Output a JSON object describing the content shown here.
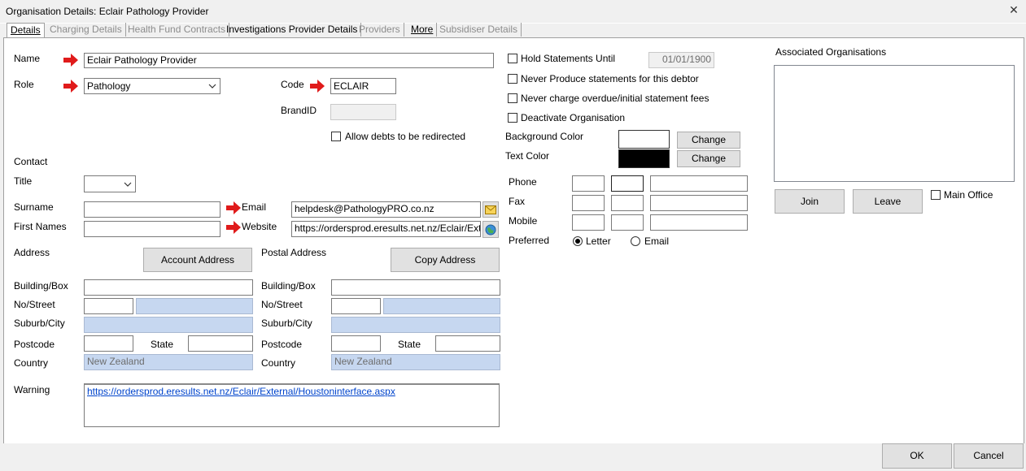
{
  "window": {
    "title": "Organisation Details: Eclair Pathology Provider",
    "close_glyph": "✕"
  },
  "tabs": [
    {
      "label": "Details",
      "state": "active"
    },
    {
      "label": "Charging Details",
      "state": "disabled"
    },
    {
      "label": "Health Fund Contracts",
      "state": "disabled"
    },
    {
      "label": "Investigations Provider Details",
      "state": "normal"
    },
    {
      "label": "Providers",
      "state": "disabled"
    },
    {
      "label": "More",
      "state": "normal"
    },
    {
      "label": "Subsidiser Details",
      "state": "disabled"
    }
  ],
  "form": {
    "name_label": "Name",
    "name_value": "Eclair Pathology Provider",
    "role_label": "Role",
    "role_value": "Pathology",
    "code_label": "Code",
    "code_value": "ECLAIR",
    "brandid_label": "BrandID",
    "brandid_value": "",
    "allow_redirect_label": "Allow debts to be redirected",
    "contact_label": "Contact",
    "title_label": "Title",
    "title_value": "",
    "surname_label": "Surname",
    "surname_value": "",
    "firstnames_label": "First Names",
    "firstnames_value": "",
    "email_label": "Email",
    "email_value": "helpdesk@PathologyPRO.co.nz",
    "website_label": "Website",
    "website_value": "https://ordersprod.eresults.net.nz/Eclair/Externa",
    "address_label": "Address",
    "account_address_button": "Account Address",
    "postal_address_label": "Postal Address",
    "copy_address_button": "Copy Address",
    "building_label": "Building/Box",
    "nostreet_label": "No/Street",
    "suburb_label": "Suburb/City",
    "postcode_label": "Postcode",
    "state_label": "State",
    "country_label": "Country",
    "country_value": "New Zealand",
    "warning_label": "Warning",
    "warning_value": "https://ordersprod.eresults.net.nz/Eclair/External/Houstoninterface.aspx"
  },
  "statements": {
    "hold_label": "Hold Statements Until",
    "hold_date": "01/01/1900",
    "never_produce_label": "Never Produce statements for this debtor",
    "never_charge_label": "Never charge overdue/initial statement fees",
    "deactivate_label": "Deactivate Organisation",
    "bg_color_label": "Background Color",
    "bg_color": "#ffffff",
    "text_color_label": "Text Color",
    "text_color": "#000000",
    "change_label": "Change"
  },
  "phones": {
    "phone_label": "Phone",
    "fax_label": "Fax",
    "mobile_label": "Mobile",
    "preferred_label": "Preferred",
    "letter_label": "Letter",
    "email_label": "Email"
  },
  "assoc": {
    "title": "Associated Organisations",
    "join_label": "Join",
    "leave_label": "Leave",
    "main_office_label": "Main Office"
  },
  "footer": {
    "ok_label": "OK",
    "cancel_label": "Cancel"
  },
  "colors": {
    "arrow": "#e01b1b",
    "field_blue": "#c6d7f0",
    "link": "#0044cc"
  }
}
